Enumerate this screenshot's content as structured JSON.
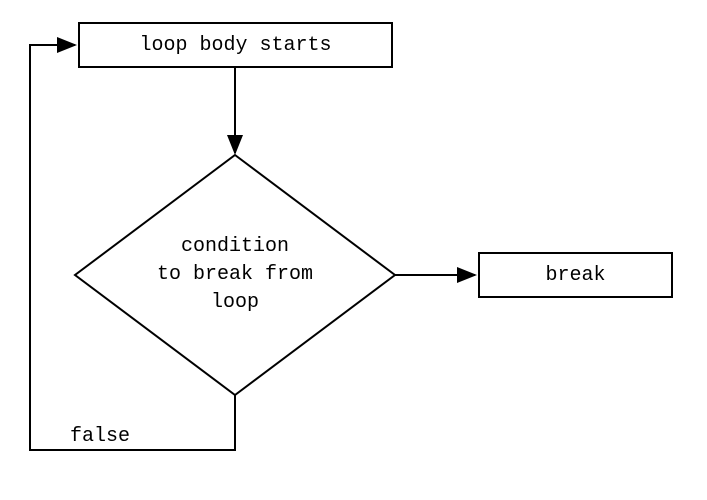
{
  "diagram": {
    "type": "flowchart",
    "topic": "loop-break-control-flow",
    "nodes": {
      "start": {
        "label": "loop body starts",
        "shape": "rectangle"
      },
      "condition": {
        "label": "condition\nto break from\nloop",
        "shape": "diamond"
      },
      "break": {
        "label": "break",
        "shape": "rectangle"
      }
    },
    "edges": {
      "false_label": "false"
    }
  }
}
